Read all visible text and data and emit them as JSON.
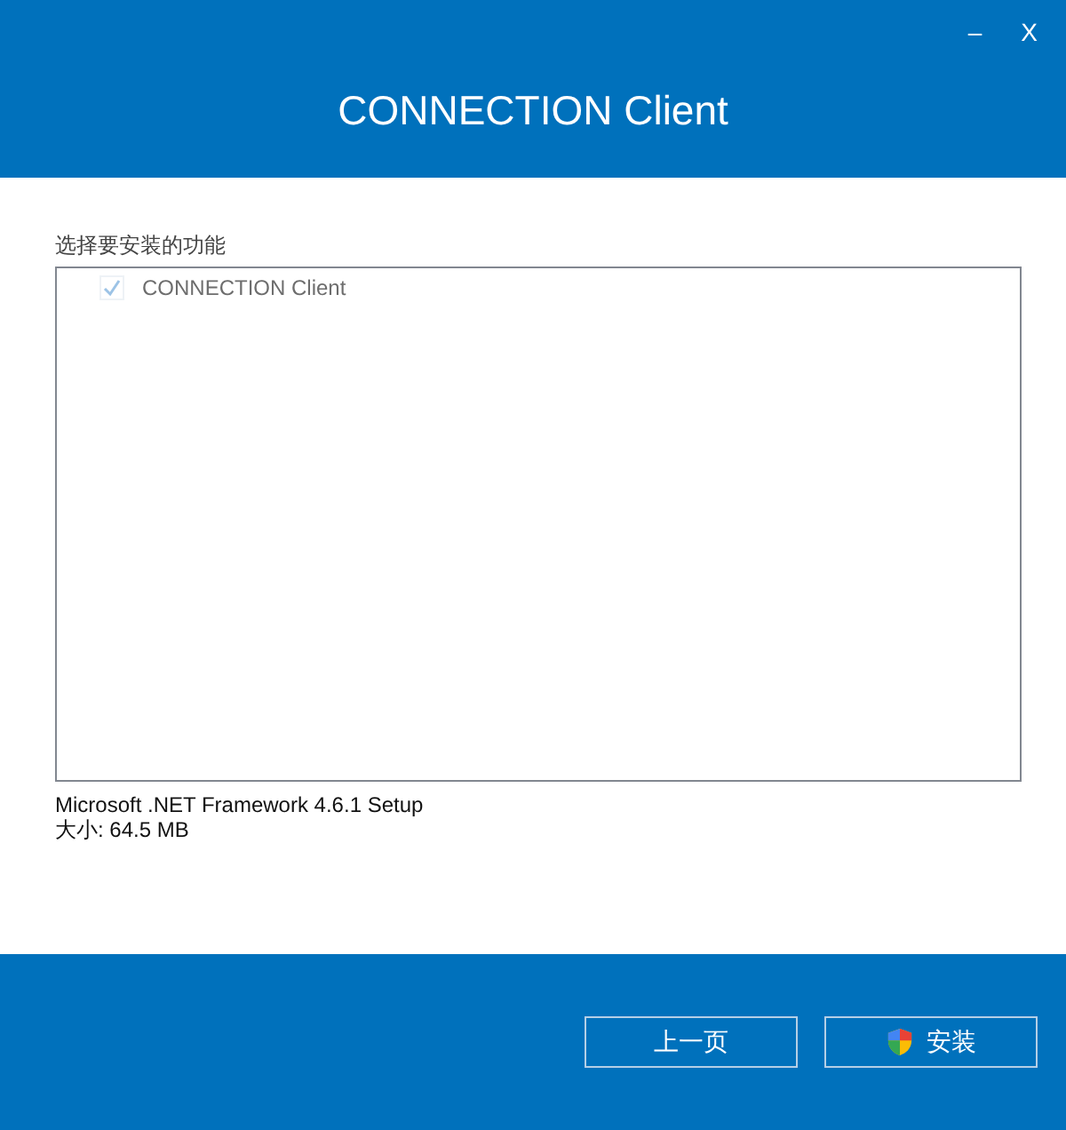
{
  "window": {
    "title": "CONNECTION Client",
    "minimize": "–",
    "close": "X"
  },
  "features": {
    "label": "选择要安装的功能",
    "items": [
      {
        "label": "CONNECTION Client",
        "checked": true,
        "disabled": true
      }
    ]
  },
  "info": [
    "Microsoft .NET Framework 4.6.1 Setup",
    "大小: 64.5 MB"
  ],
  "buttons": [
    {
      "label": "上一页",
      "kind": "plain"
    },
    {
      "label": "安装",
      "kind": "shield"
    }
  ]
}
